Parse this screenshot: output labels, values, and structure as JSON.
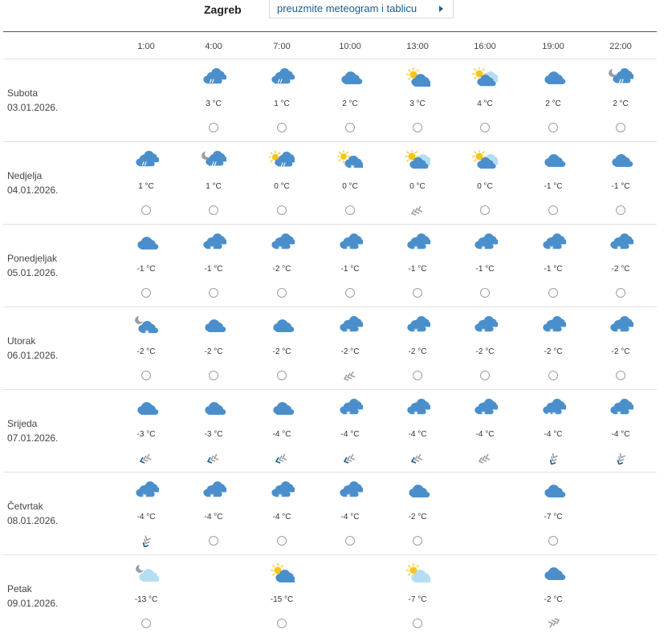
{
  "header": {
    "city": "Zagreb",
    "meteogram_button": "preuzmite meteogram i tablicu"
  },
  "colors": {
    "cloud": "#4a8fcb",
    "cloud_light": "#b6def2",
    "sun": "#f5c518",
    "moon": "#9aa0a6",
    "wind_gray": "#9aa0a6",
    "wind_blue": "#1d5c8c",
    "link": "#1d5c8c"
  },
  "hours": [
    "1:00",
    "4:00",
    "7:00",
    "10:00",
    "13:00",
    "16:00",
    "19:00",
    "22:00"
  ],
  "days": [
    {
      "name": "Subota",
      "date": "03.01.2026.",
      "cells": [
        null,
        {
          "icon": "cloud-rain-icon",
          "temp": "3 °C",
          "wind": "calm-icon"
        },
        {
          "icon": "cloud-rain-icon",
          "temp": "1 °C",
          "wind": "calm-icon"
        },
        {
          "icon": "cloud-icon",
          "temp": "2 °C",
          "wind": "calm-icon"
        },
        {
          "icon": "sun-cloud-icon",
          "temp": "3 °C",
          "wind": "calm-icon"
        },
        {
          "icon": "sun-clouds-icon",
          "temp": "4 °C",
          "wind": "calm-icon"
        },
        {
          "icon": "cloud-icon",
          "temp": "2 °C",
          "wind": "calm-icon"
        },
        {
          "icon": "moon-cloud-rain-icon",
          "temp": "2 °C",
          "wind": "calm-icon"
        }
      ]
    },
    {
      "name": "Nedjelja",
      "date": "04.01.2026.",
      "cells": [
        {
          "icon": "cloud-rain-icon",
          "temp": "1 °C",
          "wind": "calm-icon"
        },
        {
          "icon": "moon-cloud-rain-icon",
          "temp": "1 °C",
          "wind": "calm-icon"
        },
        {
          "icon": "sun-cloud-rain-icon",
          "temp": "0 °C",
          "wind": "calm-icon"
        },
        {
          "icon": "sun-cloud-snow-icon",
          "temp": "0 °C",
          "wind": "calm-icon"
        },
        {
          "icon": "sun-clouds-icon",
          "temp": "0 °C",
          "wind": "wind-sw-gray-icon"
        },
        {
          "icon": "sun-clouds-icon",
          "temp": "0 °C",
          "wind": "calm-icon"
        },
        {
          "icon": "cloud-icon",
          "temp": "-1 °C",
          "wind": "calm-icon"
        },
        {
          "icon": "cloud-icon",
          "temp": "-1 °C",
          "wind": "calm-icon"
        }
      ]
    },
    {
      "name": "Ponedjeljak",
      "date": "05.01.2026.",
      "cells": [
        {
          "icon": "cloud-icon",
          "temp": "-1 °C",
          "wind": "calm-icon"
        },
        {
          "icon": "clouds-snow-icon",
          "temp": "-1 °C",
          "wind": "calm-icon"
        },
        {
          "icon": "clouds-snow-icon",
          "temp": "-2 °C",
          "wind": "calm-icon"
        },
        {
          "icon": "clouds-snow-icon",
          "temp": "-1 °C",
          "wind": "calm-icon"
        },
        {
          "icon": "clouds-snow-icon",
          "temp": "-1 °C",
          "wind": "calm-icon"
        },
        {
          "icon": "clouds-snow-icon",
          "temp": "-1 °C",
          "wind": "calm-icon"
        },
        {
          "icon": "clouds-snow-icon",
          "temp": "-1 °C",
          "wind": "calm-icon"
        },
        {
          "icon": "clouds-snow-icon",
          "temp": "-2 °C",
          "wind": "calm-icon"
        }
      ]
    },
    {
      "name": "Utorak",
      "date": "06.01.2026.",
      "cells": [
        {
          "icon": "moon-cloud-snow-icon",
          "temp": "-2 °C",
          "wind": "calm-icon"
        },
        {
          "icon": "cloud-icon",
          "temp": "-2 °C",
          "wind": "calm-icon"
        },
        {
          "icon": "cloud-icon",
          "temp": "-2 °C",
          "wind": "calm-icon"
        },
        {
          "icon": "clouds-snow-icon",
          "temp": "-2 °C",
          "wind": "wind-sw-gray-icon"
        },
        {
          "icon": "clouds-snow-icon",
          "temp": "-2 °C",
          "wind": "calm-icon"
        },
        {
          "icon": "clouds-snow-icon",
          "temp": "-2 °C",
          "wind": "calm-icon"
        },
        {
          "icon": "clouds-snow-icon",
          "temp": "-2 °C",
          "wind": "calm-icon"
        },
        {
          "icon": "clouds-snow-icon",
          "temp": "-2 °C",
          "wind": "calm-icon"
        }
      ]
    },
    {
      "name": "Srijeda",
      "date": "07.01.2026.",
      "cells": [
        {
          "icon": "cloud-icon",
          "temp": "-3 °C",
          "wind": "wind-sw-blue-icon"
        },
        {
          "icon": "cloud-icon",
          "temp": "-3 °C",
          "wind": "wind-sw-blue-icon"
        },
        {
          "icon": "cloud-icon",
          "temp": "-4 °C",
          "wind": "wind-sw-blue-icon"
        },
        {
          "icon": "clouds-snow-icon",
          "temp": "-4 °C",
          "wind": "wind-sw-blue-icon"
        },
        {
          "icon": "clouds-snow-icon",
          "temp": "-4 °C",
          "wind": "wind-sw-blue-icon"
        },
        {
          "icon": "clouds-snow-icon",
          "temp": "-4 °C",
          "wind": "wind-sw-gray-icon"
        },
        {
          "icon": "clouds-heavy-snow-icon",
          "temp": "-4 °C",
          "wind": "wind-s-blue-icon"
        },
        {
          "icon": "clouds-snow-icon",
          "temp": "-4 °C",
          "wind": "wind-s-blue-icon"
        }
      ]
    },
    {
      "name": "Četvrtak",
      "date": "08.01.2026.",
      "cells": [
        {
          "icon": "clouds-snow-icon",
          "temp": "-4 °C",
          "wind": "wind-s-blue-icon"
        },
        {
          "icon": "clouds-snow-icon",
          "temp": "-4 °C",
          "wind": "calm-icon"
        },
        {
          "icon": "clouds-snow-icon",
          "temp": "-4 °C",
          "wind": "calm-icon"
        },
        {
          "icon": "clouds-snow-icon",
          "temp": "-4 °C",
          "wind": "calm-icon"
        },
        {
          "icon": "cloud-icon",
          "temp": "-2 °C",
          "wind": "calm-icon"
        },
        null,
        {
          "icon": "cloud-icon",
          "temp": "-7 °C",
          "wind": "calm-icon"
        },
        null
      ]
    },
    {
      "name": "Petak",
      "date": "09.01.2026.",
      "cells": [
        {
          "icon": "moon-cloud-light-icon",
          "temp": "-13 °C",
          "wind": "calm-icon"
        },
        null,
        {
          "icon": "sun-cloud-icon",
          "temp": "-15 °C",
          "wind": "calm-icon"
        },
        null,
        {
          "icon": "sun-cloud-light-icon",
          "temp": "-7 °C",
          "wind": "calm-icon"
        },
        null,
        {
          "icon": "cloud-icon",
          "temp": "-2 °C",
          "wind": "wind-ne-gray-icon"
        },
        null
      ]
    }
  ]
}
